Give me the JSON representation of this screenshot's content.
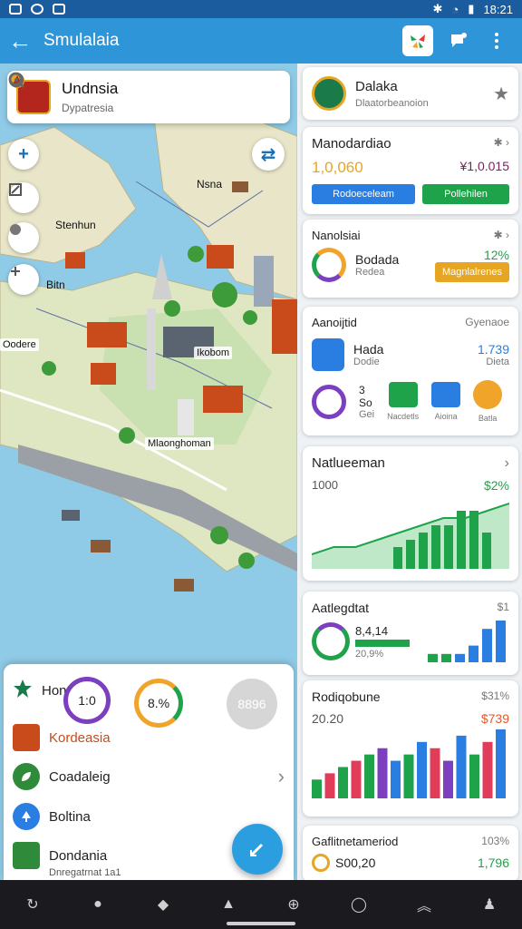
{
  "status": {
    "time": "18:21"
  },
  "appbar": {
    "title": "Smulalaia"
  },
  "map": {
    "location": {
      "title": "Undnsia",
      "subtitle": "Dypatresia"
    },
    "labels": [
      "Nsna",
      "Stenhun",
      "Bitn",
      "Oodere",
      "Ikobom",
      "Mlaonghoman"
    ]
  },
  "sheet": {
    "header": "Hontreson",
    "gauge1": "1:0",
    "gauge2": "8.%",
    "gauge3": "8896",
    "items": [
      {
        "label": "Kordeasia",
        "color": "#c94b1b"
      },
      {
        "label": "Coadaleig",
        "color": "#222222"
      },
      {
        "label": "Boltina",
        "color": "#222222"
      },
      {
        "label": "Dondania",
        "color": "#222222"
      }
    ],
    "item4_sub": "Dnregatrnat 1a1"
  },
  "panel": {
    "top": {
      "title": "Dalaka",
      "subtitle": "Dlaatorbeanoion"
    },
    "card1": {
      "title": "Manodardiao",
      "value_left": "1,0,060",
      "value_right": "¥1,0.015",
      "btn1": "Rodoeceleam",
      "btn2": "Pollehilen"
    },
    "card2": {
      "title": "Nanolsiai",
      "name": "Bodada",
      "sub": "Redea",
      "pct": "12%",
      "tag": "Magnlalrenes"
    },
    "card3": {
      "title": "Aanoijtid",
      "link": "Gyenaoe",
      "name": "Hada",
      "sub": "Dodie",
      "value": "1.739",
      "value_sub": "Dieta",
      "ring_value": "3",
      "ring_sub": "So",
      "ring_label": "Gei",
      "icons": [
        "Nacdetls",
        "Aioina",
        "Batla"
      ]
    },
    "card4": {
      "title": "Natlueeman",
      "left": "1000",
      "right": "$2%"
    },
    "card5": {
      "title": "Aatlegdtat",
      "link": "$1",
      "v1": "8,4,14",
      "v2": "20,9%"
    },
    "card6": {
      "title": "Rodiqobune",
      "link": "$31%",
      "left": "20.20",
      "right": "$739"
    },
    "card7": {
      "title": "Gaflitnetameriod",
      "link": "103%",
      "left": "S00,20",
      "right": "1,796"
    }
  },
  "colors": {
    "primary": "#2f95d9",
    "green": "#1fa34a",
    "blue": "#2a7de1",
    "orange": "#f0a42a",
    "purple": "#7b3fbf"
  },
  "chart_data": [
    {
      "type": "area",
      "title": "Natlueeman",
      "values": [
        2,
        3,
        3,
        4,
        5,
        6,
        7,
        7,
        8,
        9
      ]
    },
    {
      "type": "bar",
      "title": "Natlueeman",
      "values": [
        3,
        4,
        5,
        6,
        6,
        8,
        8,
        5
      ]
    },
    {
      "type": "bar",
      "title": "Aatlegdtat",
      "values": [
        1,
        1,
        1,
        2,
        4,
        5
      ]
    },
    {
      "type": "bar",
      "title": "Rodiqobune",
      "values": [
        3,
        4,
        5,
        6,
        7,
        8,
        6,
        7,
        9,
        8,
        6,
        10,
        7,
        9,
        11
      ]
    }
  ]
}
